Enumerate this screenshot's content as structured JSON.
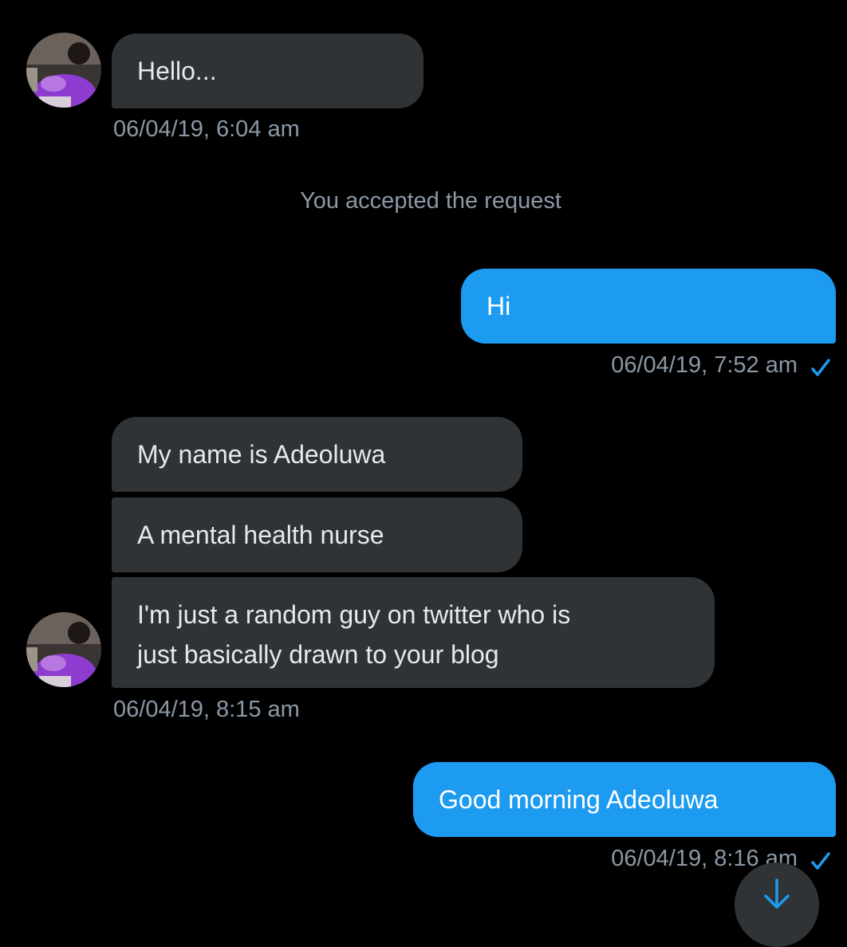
{
  "messages": [
    {
      "text": "Hello..."
    },
    {
      "text": "Hi"
    },
    {
      "text": "My name is Adeoluwa"
    },
    {
      "text": "A mental health nurse"
    },
    {
      "text": "I'm just a random guy on twitter who is\njust basically drawn to your blog"
    },
    {
      "text": "Good morning Adeoluwa"
    }
  ],
  "timestamps": [
    "06/04/19, 6:04 am",
    "06/04/19, 7:52 am",
    "06/04/19, 8:15 am",
    "06/04/19, 8:16 am"
  ],
  "system_message": "You accepted the request",
  "icons": {
    "read_receipt": "check-icon",
    "scroll_down": "arrow-down-icon",
    "avatar": "avatar"
  },
  "colors": {
    "background": "#000000",
    "incoming_bubble": "#2f3336",
    "outgoing_bubble": "#1d9bf0",
    "timestamp": "#8b98a5",
    "check": "#1d9bf0"
  }
}
